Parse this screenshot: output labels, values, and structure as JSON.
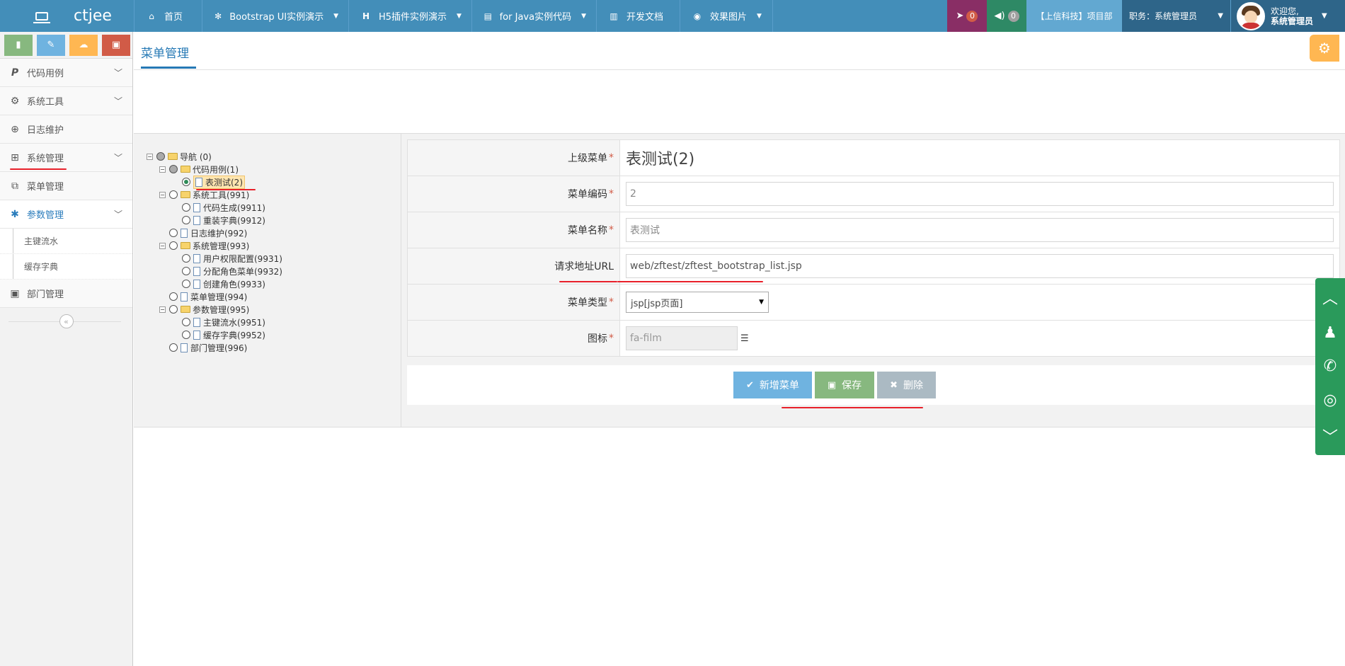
{
  "navbar": {
    "brand": "ctjee",
    "items": [
      {
        "icon": "home-icon",
        "label": "首页",
        "caret": false
      },
      {
        "icon": "leaf-icon",
        "label": "Bootstrap UI实例演示",
        "caret": true
      },
      {
        "icon": "h-icon",
        "label": "H5插件实例演示",
        "caret": true
      },
      {
        "icon": "file-code-icon",
        "label": "for Java实例代码",
        "caret": true
      },
      {
        "icon": "doc-icon",
        "label": "开发文档",
        "caret": false
      },
      {
        "icon": "camera-icon",
        "label": "效果图片",
        "caret": true
      }
    ],
    "tasks_count": "0",
    "notice_count": "0",
    "company": "【上信科技】项目部",
    "role": "职务：系统管理员",
    "welcome": "欢迎您,",
    "user": "系统管理员"
  },
  "sidebar": {
    "menu": [
      {
        "label": "代码用例",
        "arrow": true
      },
      {
        "label": "系统工具",
        "arrow": true
      },
      {
        "label": "日志维护",
        "arrow": false
      },
      {
        "label": "系统管理",
        "arrow": true
      },
      {
        "label": "菜单管理",
        "arrow": false
      },
      {
        "label": "参数管理",
        "arrow": true
      }
    ],
    "sub": [
      "主键流水",
      "缓存字典"
    ],
    "last": "部门管理"
  },
  "page": {
    "tab": "菜单管理"
  },
  "tree": {
    "nodes": [
      "导航 (0)",
      "代码用例(1)",
      "表测试(2)",
      "系统工具(991)",
      "代码生成(9911)",
      "重装字典(9912)",
      "日志维护(992)",
      "系统管理(993)",
      "用户权限配置(9931)",
      "分配角色菜单(9932)",
      "创建角色(9933)",
      "菜单管理(994)",
      "参数管理(995)",
      "主键流水(9951)",
      "缓存字典(9952)",
      "部门管理(996)"
    ]
  },
  "form": {
    "parent_label": "上级菜单",
    "parent_value": "表测试(2)",
    "code_label": "菜单编码",
    "code_value": "2",
    "name_label": "菜单名称",
    "name_value": "表测试",
    "url_label": "请求地址URL",
    "url_value": "web/zftest/zftest_bootstrap_list.jsp",
    "type_label": "菜单类型",
    "type_value": "jsp[jsp页面]",
    "icon_label": "图标",
    "icon_value": "fa-film",
    "required_mark": "*"
  },
  "buttons": {
    "add": "新增菜单",
    "save": "保存",
    "delete": "删除"
  },
  "colors": {
    "navbar": "#438eb9",
    "accent": "#2679b5",
    "annotation": "#e8202a"
  }
}
